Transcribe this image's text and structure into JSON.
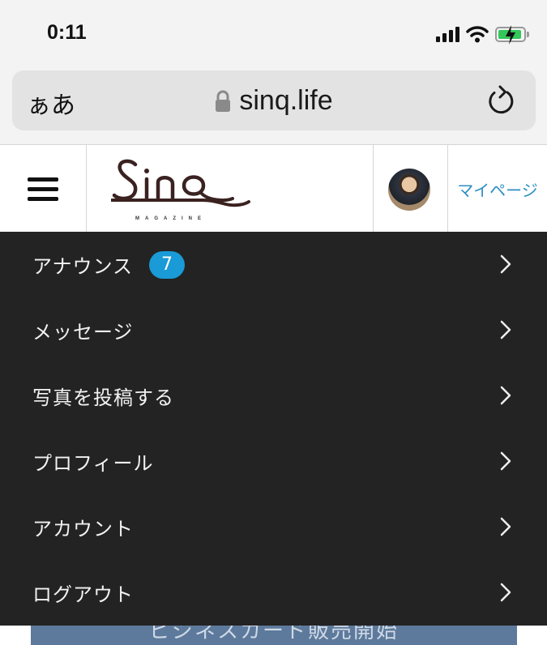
{
  "status_bar": {
    "time": "0:11"
  },
  "browser": {
    "text_size_button": "ぁあ",
    "url": "sinq.life"
  },
  "site": {
    "logo_text": "Sinq",
    "logo_subtitle": "MAGAZINE",
    "mypage_label": "マイページ"
  },
  "menu": {
    "items": [
      {
        "label": "アナウンス",
        "badge": "7"
      },
      {
        "label": "メッセージ"
      },
      {
        "label": "写真を投稿する"
      },
      {
        "label": "プロフィール"
      },
      {
        "label": "アカウント"
      },
      {
        "label": "ログアウト"
      }
    ]
  },
  "banner": {
    "text": "ビジネスカード販売開始"
  },
  "colors": {
    "menu_background": "#232323",
    "badge": "#1a9ad6",
    "link": "#2b8ec4",
    "battery": "#34c759"
  }
}
